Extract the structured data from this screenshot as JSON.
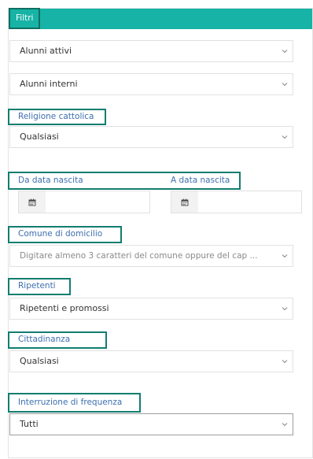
{
  "header": {
    "title": "Filtri"
  },
  "filters": {
    "alunni_stato": {
      "value": "Alunni attivi"
    },
    "alunni_tipo": {
      "value": "Alunni interni"
    },
    "religione": {
      "label": "Religione cattolica",
      "value": "Qualsiasi"
    },
    "da_data": {
      "label": "Da data nascita",
      "value": ""
    },
    "a_data": {
      "label": "A data nascita",
      "value": ""
    },
    "comune": {
      "label": "Comune di domicilio",
      "placeholder": "Digitare almeno 3 caratteri del comune oppure del cap ..."
    },
    "ripetenti": {
      "label": "Ripetenti",
      "value": "Ripetenti e promossi"
    },
    "cittadinanza": {
      "label": "Cittadinanza",
      "value": "Qualsiasi"
    },
    "interruzione": {
      "label": "Interruzione di frequenza",
      "value": "Tutti"
    }
  },
  "icons": {
    "calendar": "calendar-icon",
    "dropdown": "chevron-down-icon"
  },
  "colors": {
    "header": "#17b3a6",
    "highlight_border": "#127d70",
    "label_text": "#3d6fad"
  }
}
